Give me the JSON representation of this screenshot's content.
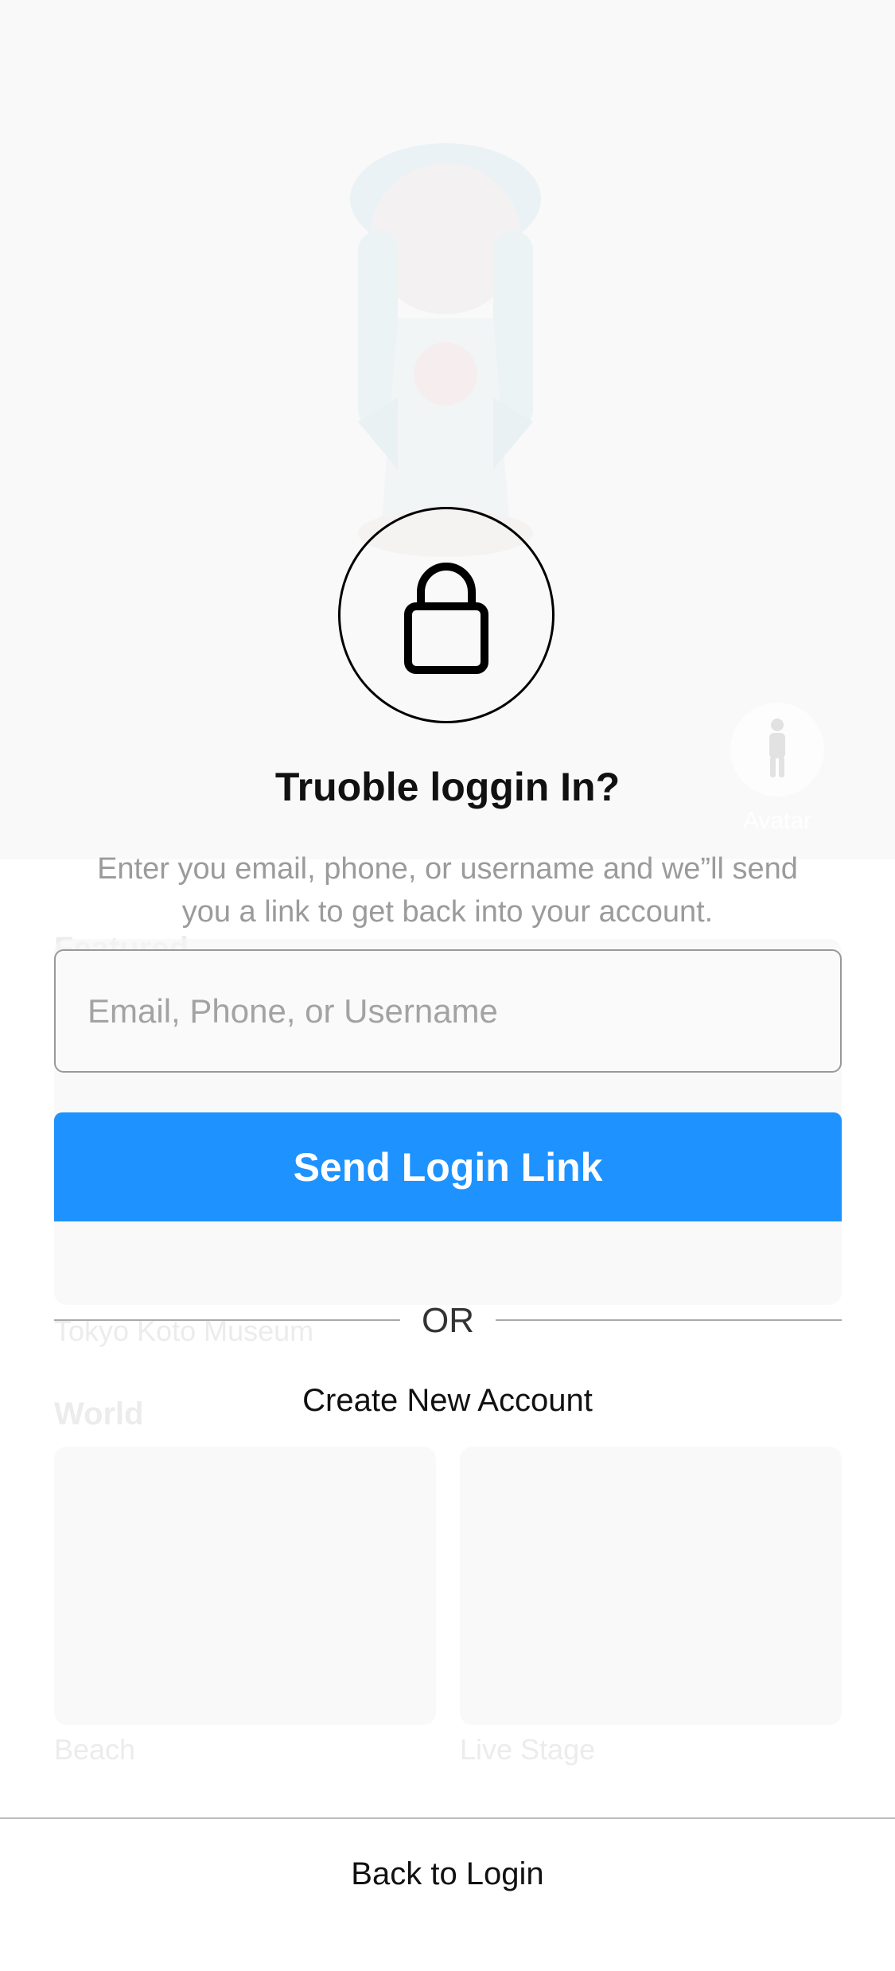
{
  "background": {
    "featured_heading": "Featured",
    "featured_item": "Tokyo Koto Museum",
    "world_heading": "World",
    "world_items": [
      "Beach",
      "Live Stage"
    ],
    "avatar_label": "Avatar"
  },
  "dialog": {
    "icon": "lock-icon",
    "title": "Truoble loggin In?",
    "description": "Enter you email, phone, or username and we”ll send you a link to get back into your account.",
    "input_placeholder": "Email, Phone, or Username",
    "input_value": "",
    "send_button": "Send Login Link",
    "or_label": "OR",
    "create_account": "Create New Account",
    "back_to_login": "Back to Login"
  },
  "colors": {
    "accent": "#1e93ff",
    "muted_text": "#9b9b9b"
  }
}
